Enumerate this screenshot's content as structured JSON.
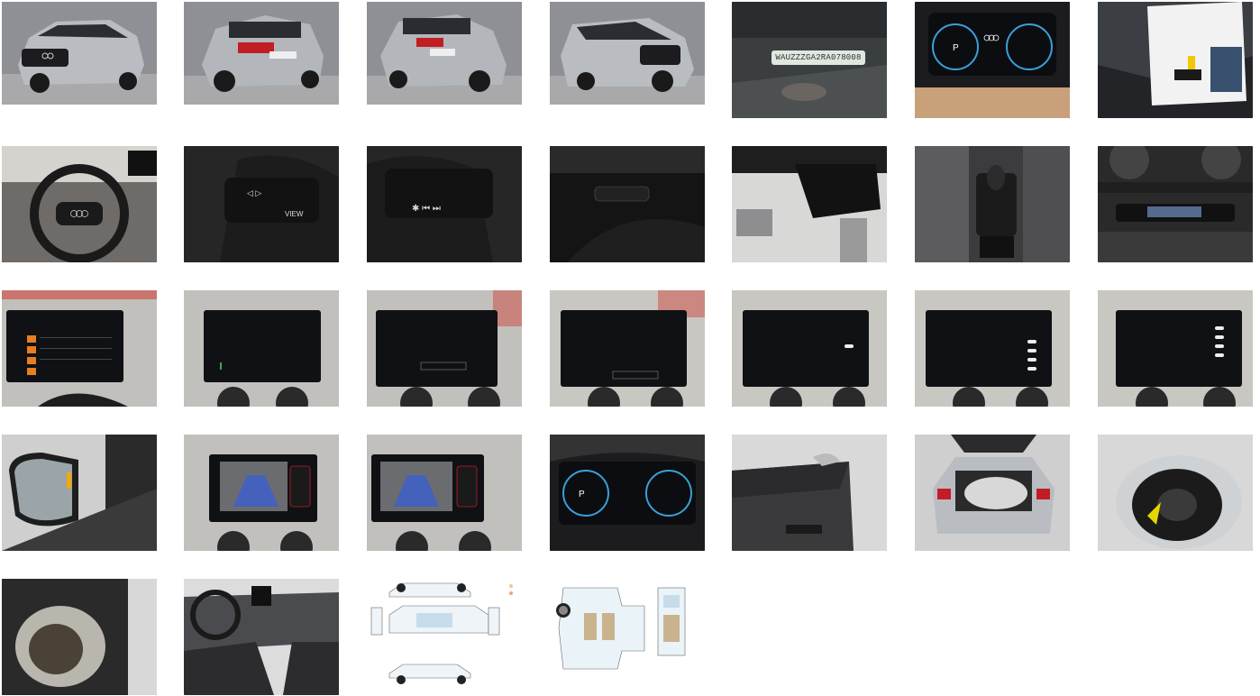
{
  "gallery": {
    "vin": "WAUZZZGA2RA078008",
    "thumbnails": [
      {
        "name": "photo-front-left-exterior"
      },
      {
        "name": "photo-rear-left-exterior"
      },
      {
        "name": "photo-rear-right-exterior"
      },
      {
        "name": "photo-front-right-exterior"
      },
      {
        "name": "photo-vin-plate"
      },
      {
        "name": "photo-instrument-cluster"
      },
      {
        "name": "photo-documents-and-keys"
      },
      {
        "name": "photo-steering-wheel"
      },
      {
        "name": "photo-steering-left-buttons"
      },
      {
        "name": "photo-steering-right-buttons"
      },
      {
        "name": "photo-stalk-controls"
      },
      {
        "name": "photo-rearview-mirror"
      },
      {
        "name": "photo-gear-selector"
      },
      {
        "name": "photo-climate-controls"
      },
      {
        "name": "photo-infotainment-radio"
      },
      {
        "name": "photo-infotainment-phone"
      },
      {
        "name": "photo-infotainment-carplay"
      },
      {
        "name": "photo-infotainment-service"
      },
      {
        "name": "photo-infotainment-settings"
      },
      {
        "name": "photo-infotainment-assist-1"
      },
      {
        "name": "photo-infotainment-assist-2"
      },
      {
        "name": "photo-side-mirror"
      },
      {
        "name": "photo-rear-camera-1"
      },
      {
        "name": "photo-rear-camera-2"
      },
      {
        "name": "photo-cluster-service"
      },
      {
        "name": "photo-door-panel"
      },
      {
        "name": "photo-open-trunk"
      },
      {
        "name": "photo-tires-in-bag"
      },
      {
        "name": "photo-rear-seat-bag"
      },
      {
        "name": "photo-dashboard-interior"
      },
      {
        "name": "diagram-exterior-damage"
      },
      {
        "name": "diagram-interior-damage"
      }
    ]
  }
}
